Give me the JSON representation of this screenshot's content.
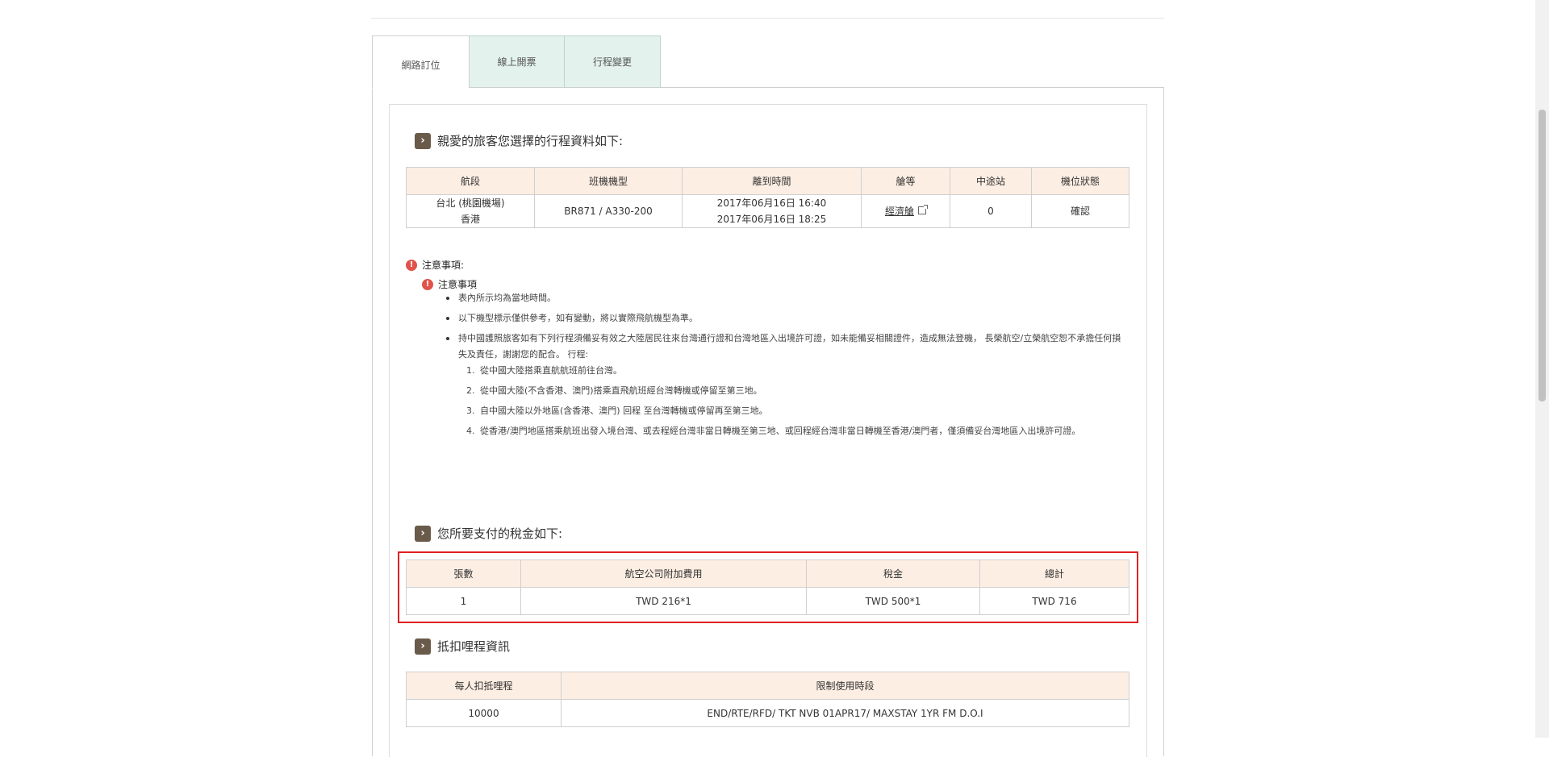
{
  "tabs": [
    {
      "label": "網路訂位"
    },
    {
      "label": "線上開票"
    },
    {
      "label": "行程變更"
    }
  ],
  "itinerary": {
    "heading": "親愛的旅客您選擇的行程資料如下:",
    "headers": [
      "航段",
      "班機機型",
      "離到時間",
      "艙等",
      "中途站",
      "機位狀態"
    ],
    "row": {
      "from": "台北 (桃園機場)",
      "to": "香港",
      "flight": "BR871 / A330-200",
      "depart": "2017年06月16日 16:40",
      "arrive": "2017年06月16日 18:25",
      "cabin": "經濟艙",
      "stops": "0",
      "status": "確認"
    }
  },
  "notice": {
    "title": "注意事項:",
    "subtitle": "注意事項",
    "items": [
      "表內所示均為當地時間。",
      "以下機型標示僅供參考，如有變動，將以實際飛航機型為準。",
      "持中國護照旅客如有下列行程須備妥有效之大陸居民往來台灣通行證和台灣地區入出境許可證，如未能備妥相關證件，造成無法登機， 長榮航空/立榮航空恕不承擔任何損失及責任，謝謝您的配合。 行程:"
    ],
    "routes": [
      {
        "num": "1.",
        "text": "從中國大陸搭乘直航航班前往台灣。"
      },
      {
        "num": "2.",
        "text": "從中國大陸(不含香港、澳門)搭乘直飛航班經台灣轉機或停留至第三地。"
      },
      {
        "num": "3.",
        "text": "自中國大陸以外地區(含香港、澳門) 回程 至台灣轉機或停留再至第三地。"
      },
      {
        "num": "4.",
        "text": "從香港/澳門地區搭乘航班出發入境台灣、或去程經台灣非當日轉機至第三地、或回程經台灣非當日轉機至香港/澳門者，僅須備妥台灣地區入出境許可證。"
      }
    ]
  },
  "tax": {
    "heading": "您所要支付的稅金如下:",
    "headers": [
      "張數",
      "航空公司附加費用",
      "稅金",
      "總計"
    ],
    "row": [
      "1",
      "TWD 216*1",
      "TWD 500*1",
      "TWD 716"
    ]
  },
  "miles": {
    "heading": "抵扣哩程資訊",
    "headers": [
      "每人扣抵哩程",
      "限制使用時段"
    ],
    "row": [
      "10000",
      "END/RTE/RFD/ TKT NVB 01APR17/ MAXSTAY 1YR FM D.O.I"
    ]
  },
  "icons": {
    "section": "chevron-right-icon",
    "alert": "exclamation-icon",
    "external": "external-link-icon"
  },
  "colors": {
    "header_bg": "#fdeee3",
    "tab_bg": "#e3f2ec",
    "chevron_bg": "#6a5a4a",
    "alert": "#e0524b",
    "highlight": "#e02020"
  }
}
